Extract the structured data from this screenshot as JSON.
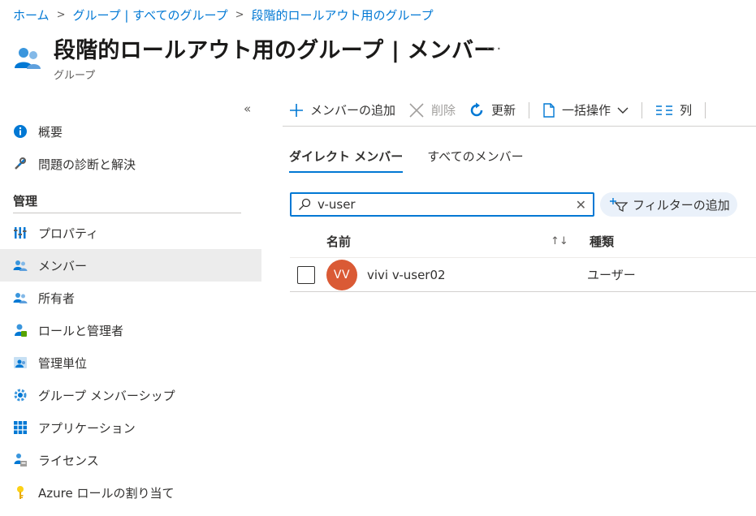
{
  "breadcrumb": [
    "ホーム",
    "グループ | すべてのグループ",
    "段階的ロールアウト用のグループ"
  ],
  "header": {
    "title": "段階的ロールアウト用のグループ | メンバー",
    "subtitle": "グループ",
    "more": "···"
  },
  "sidebar": {
    "collapse": "«",
    "top_items": [
      {
        "label": "概要",
        "icon": "info-icon"
      },
      {
        "label": "問題の診断と解決",
        "icon": "wrench-icon"
      }
    ],
    "section_title": "管理",
    "items": [
      {
        "label": "プロパティ",
        "icon": "properties-icon"
      },
      {
        "label": "メンバー",
        "icon": "users-icon"
      },
      {
        "label": "所有者",
        "icon": "owners-icon"
      },
      {
        "label": "ロールと管理者",
        "icon": "roles-icon"
      },
      {
        "label": "管理単位",
        "icon": "admin-units-icon"
      },
      {
        "label": "グループ メンバーシップ",
        "icon": "group-membership-icon"
      },
      {
        "label": "アプリケーション",
        "icon": "apps-icon"
      },
      {
        "label": "ライセンス",
        "icon": "license-icon"
      },
      {
        "label": "Azure ロールの割り当て",
        "icon": "key-icon"
      }
    ]
  },
  "toolbar": {
    "add_member": "メンバーの追加",
    "delete": "削除",
    "refresh": "更新",
    "bulk": "一括操作",
    "columns": "列"
  },
  "tabs": [
    "ダイレクト メンバー",
    "すべてのメンバー"
  ],
  "search": {
    "value": "v-user"
  },
  "filter": {
    "label": "フィルターの追加"
  },
  "table": {
    "headers": {
      "name": "名前",
      "type": "種類"
    },
    "rows": [
      {
        "initials": "VV",
        "name": "vivi v-user02",
        "type": "ユーザー"
      }
    ]
  },
  "colors": {
    "accent": "#0078d4",
    "avatar": "#da5a35",
    "active_bg": "#ececec"
  }
}
